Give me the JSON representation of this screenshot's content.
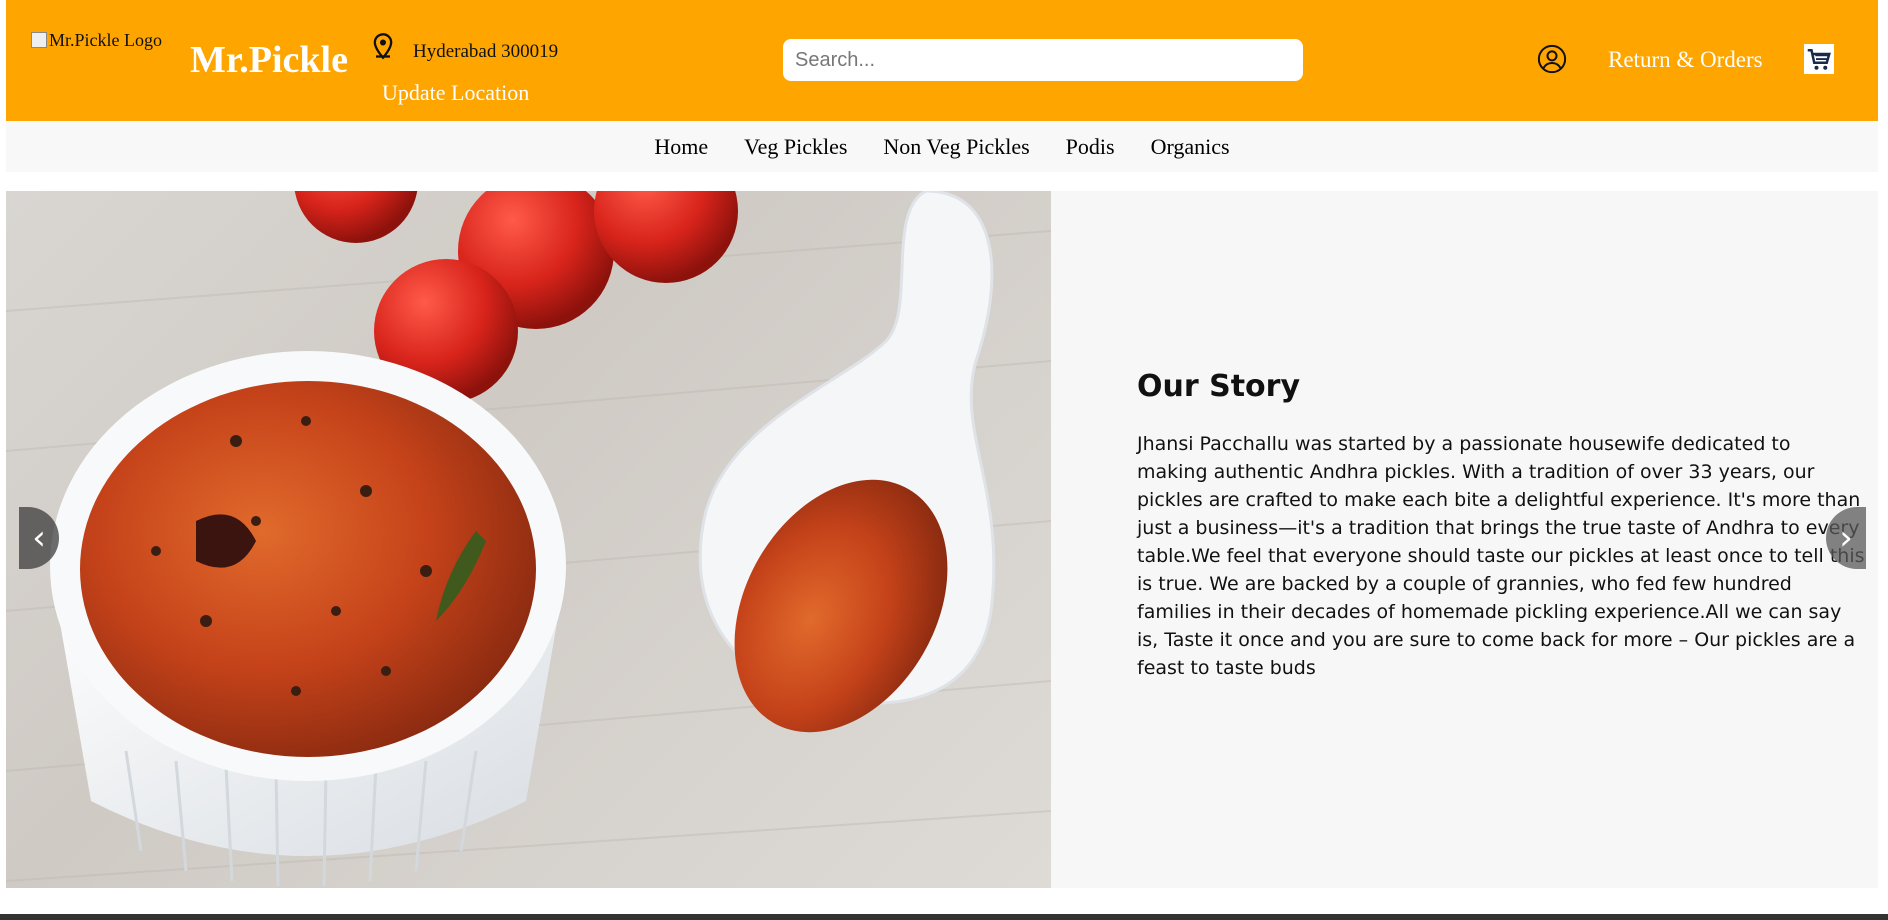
{
  "header": {
    "logo_alt": "Mr.Pickle Logo",
    "brand": "Mr.Pickle",
    "location": "Hyderabad 300019",
    "update_location": "Update Location",
    "search_placeholder": "Search...",
    "orders_label": "Return & Orders",
    "icons": {
      "location": "map-pin-icon",
      "user": "user-circle-icon",
      "cart": "cart-icon"
    },
    "background_color": "#FFA500"
  },
  "nav": {
    "items": [
      {
        "label": "Home"
      },
      {
        "label": "Veg Pickles"
      },
      {
        "label": "Non Veg Pickles"
      },
      {
        "label": "Podis"
      },
      {
        "label": "Organics"
      }
    ]
  },
  "hero": {
    "heading": "Our Story",
    "body": "Jhansi Pacchallu was started by a passionate housewife dedicated to making authentic Andhra pickles. With a tradition of over 33 years, our pickles are crafted to make each bite a delightful experience. It's more than just a business—it's a tradition that brings the true taste of Andhra to every table.We feel that everyone should taste our pickles at least once to tell this is true. We are backed by a couple of grannies, who fed few hundred families in their decades of homemade pickling experience.All we can say is, Taste it once and you are sure to come back for more – Our pickles are a feast to taste buds",
    "prev_arrow": "‹",
    "next_arrow": "›"
  }
}
